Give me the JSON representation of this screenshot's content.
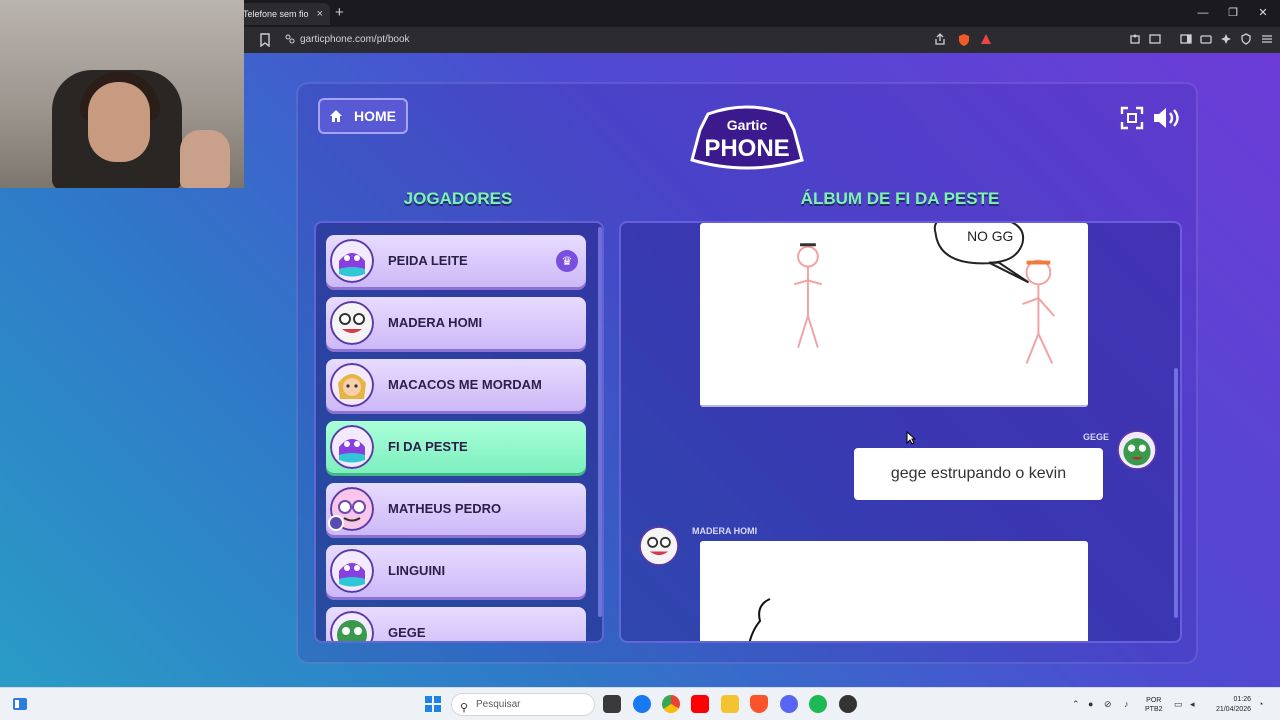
{
  "browser": {
    "tab_title": "Telefone sem fio",
    "tab_close": "×",
    "new_tab": "+",
    "url": "garticphone.com/pt/book",
    "window_minimize": "—",
    "window_restore": "❐",
    "window_close": "✕"
  },
  "game": {
    "home_label": "HOME",
    "logo_top": "Gartic",
    "logo_bottom": "PHONE",
    "players_title": "JOGADORES",
    "album_title": "ÁLBUM DE FI DA PESTE",
    "players": [
      {
        "name": "PEIDA LEITE",
        "avatar": "bird-purple",
        "owner": true
      },
      {
        "name": "MADERA HOMI",
        "avatar": "clown"
      },
      {
        "name": "MACACOS ME MORDAM",
        "avatar": "blonde-girl"
      },
      {
        "name": "FI DA PESTE",
        "avatar": "bird-purple",
        "active": true
      },
      {
        "name": "MATHEUS PEDRO",
        "avatar": "pink-glasses",
        "badge": "user-icon"
      },
      {
        "name": "LINGUINI",
        "avatar": "bird-purple"
      },
      {
        "name": "GEGE",
        "avatar": "green-monster"
      }
    ],
    "album": {
      "drawing_1_text": "NO GG",
      "message_author": "GEGE",
      "message_text": "gege estrupando o kevin",
      "drawing_2_author": "MADERA HOMI"
    }
  },
  "taskbar": {
    "search_placeholder": "Pesquisar",
    "lang_line1": "POR",
    "lang_line2": "PTB2",
    "time": "01:26",
    "date": "21/04/2026"
  },
  "colors": {
    "accent_green": "#7df3ae",
    "page_purple": "#6c3cd8",
    "page_blue": "#2a9cc6",
    "player_card": "#d9c9fb",
    "player_active": "#8ff4c8"
  }
}
